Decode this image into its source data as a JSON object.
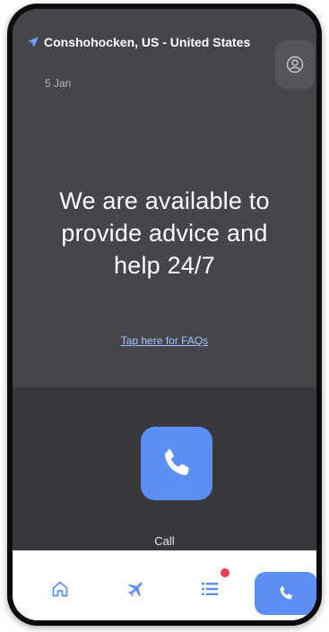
{
  "header": {
    "location": "Conshohocken, US - United States",
    "date": "5 Jan"
  },
  "main": {
    "headline_line1": "We are available to",
    "headline_line2": "provide advice and",
    "headline_line3": "help 24/7",
    "faq_link": "Tap here for FAQs"
  },
  "call": {
    "label": "Call"
  },
  "tabbar": {
    "items": [
      "home-icon",
      "airplane-icon",
      "list-icon",
      "phone-icon"
    ],
    "active": "phone-icon",
    "notification_on": "list-icon"
  },
  "colors": {
    "background": "#45464c",
    "panel": "#38393e",
    "accent": "#5b8ff6",
    "badge": "#ef3b4e",
    "link": "#a9c6ff"
  }
}
